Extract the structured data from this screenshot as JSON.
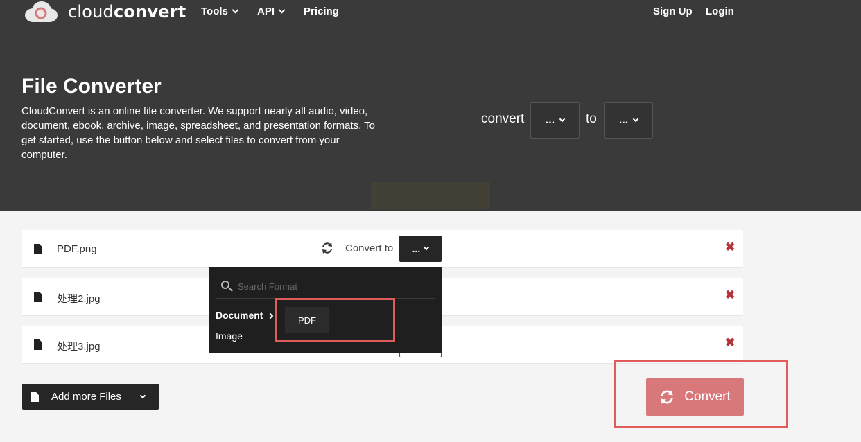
{
  "app": {
    "logo_light": "cloud",
    "logo_bold": "convert",
    "accent_color": "#d9787b",
    "danger_color": "#b4333a"
  },
  "nav": {
    "tools": "Tools",
    "api": "API",
    "pricing": "Pricing",
    "signup": "Sign Up",
    "login": "Login"
  },
  "hero": {
    "title": "File Converter",
    "description": "CloudConvert is an online file converter. We support nearly all audio, video, document, ebook, archive, image, spreadsheet, and presentation formats. To get started, use the button below and select files to convert from your computer.",
    "convert_label": "convert",
    "to_label": "to",
    "from_select": "...",
    "to_select": "..."
  },
  "files": [
    {
      "name": "PDF.png"
    },
    {
      "name": "处理2.jpg"
    },
    {
      "name": "处理3.jpg"
    }
  ],
  "row_controls": {
    "convert_to_label": "Convert to",
    "select_value": "...",
    "remove_symbol": "✖"
  },
  "dropdown": {
    "search_placeholder": "Search Format",
    "categories": [
      "Document",
      "Image"
    ],
    "options": [
      "PDF"
    ]
  },
  "actions": {
    "add_more": "Add more Files",
    "convert": "Convert"
  },
  "icons": [
    "cloudconvert-logo-icon",
    "file-icon",
    "refresh-icon",
    "remove-icon",
    "search-icon",
    "add-file-icon",
    "chevron-down-icon",
    "chevron-right-icon",
    "convert-icon"
  ]
}
